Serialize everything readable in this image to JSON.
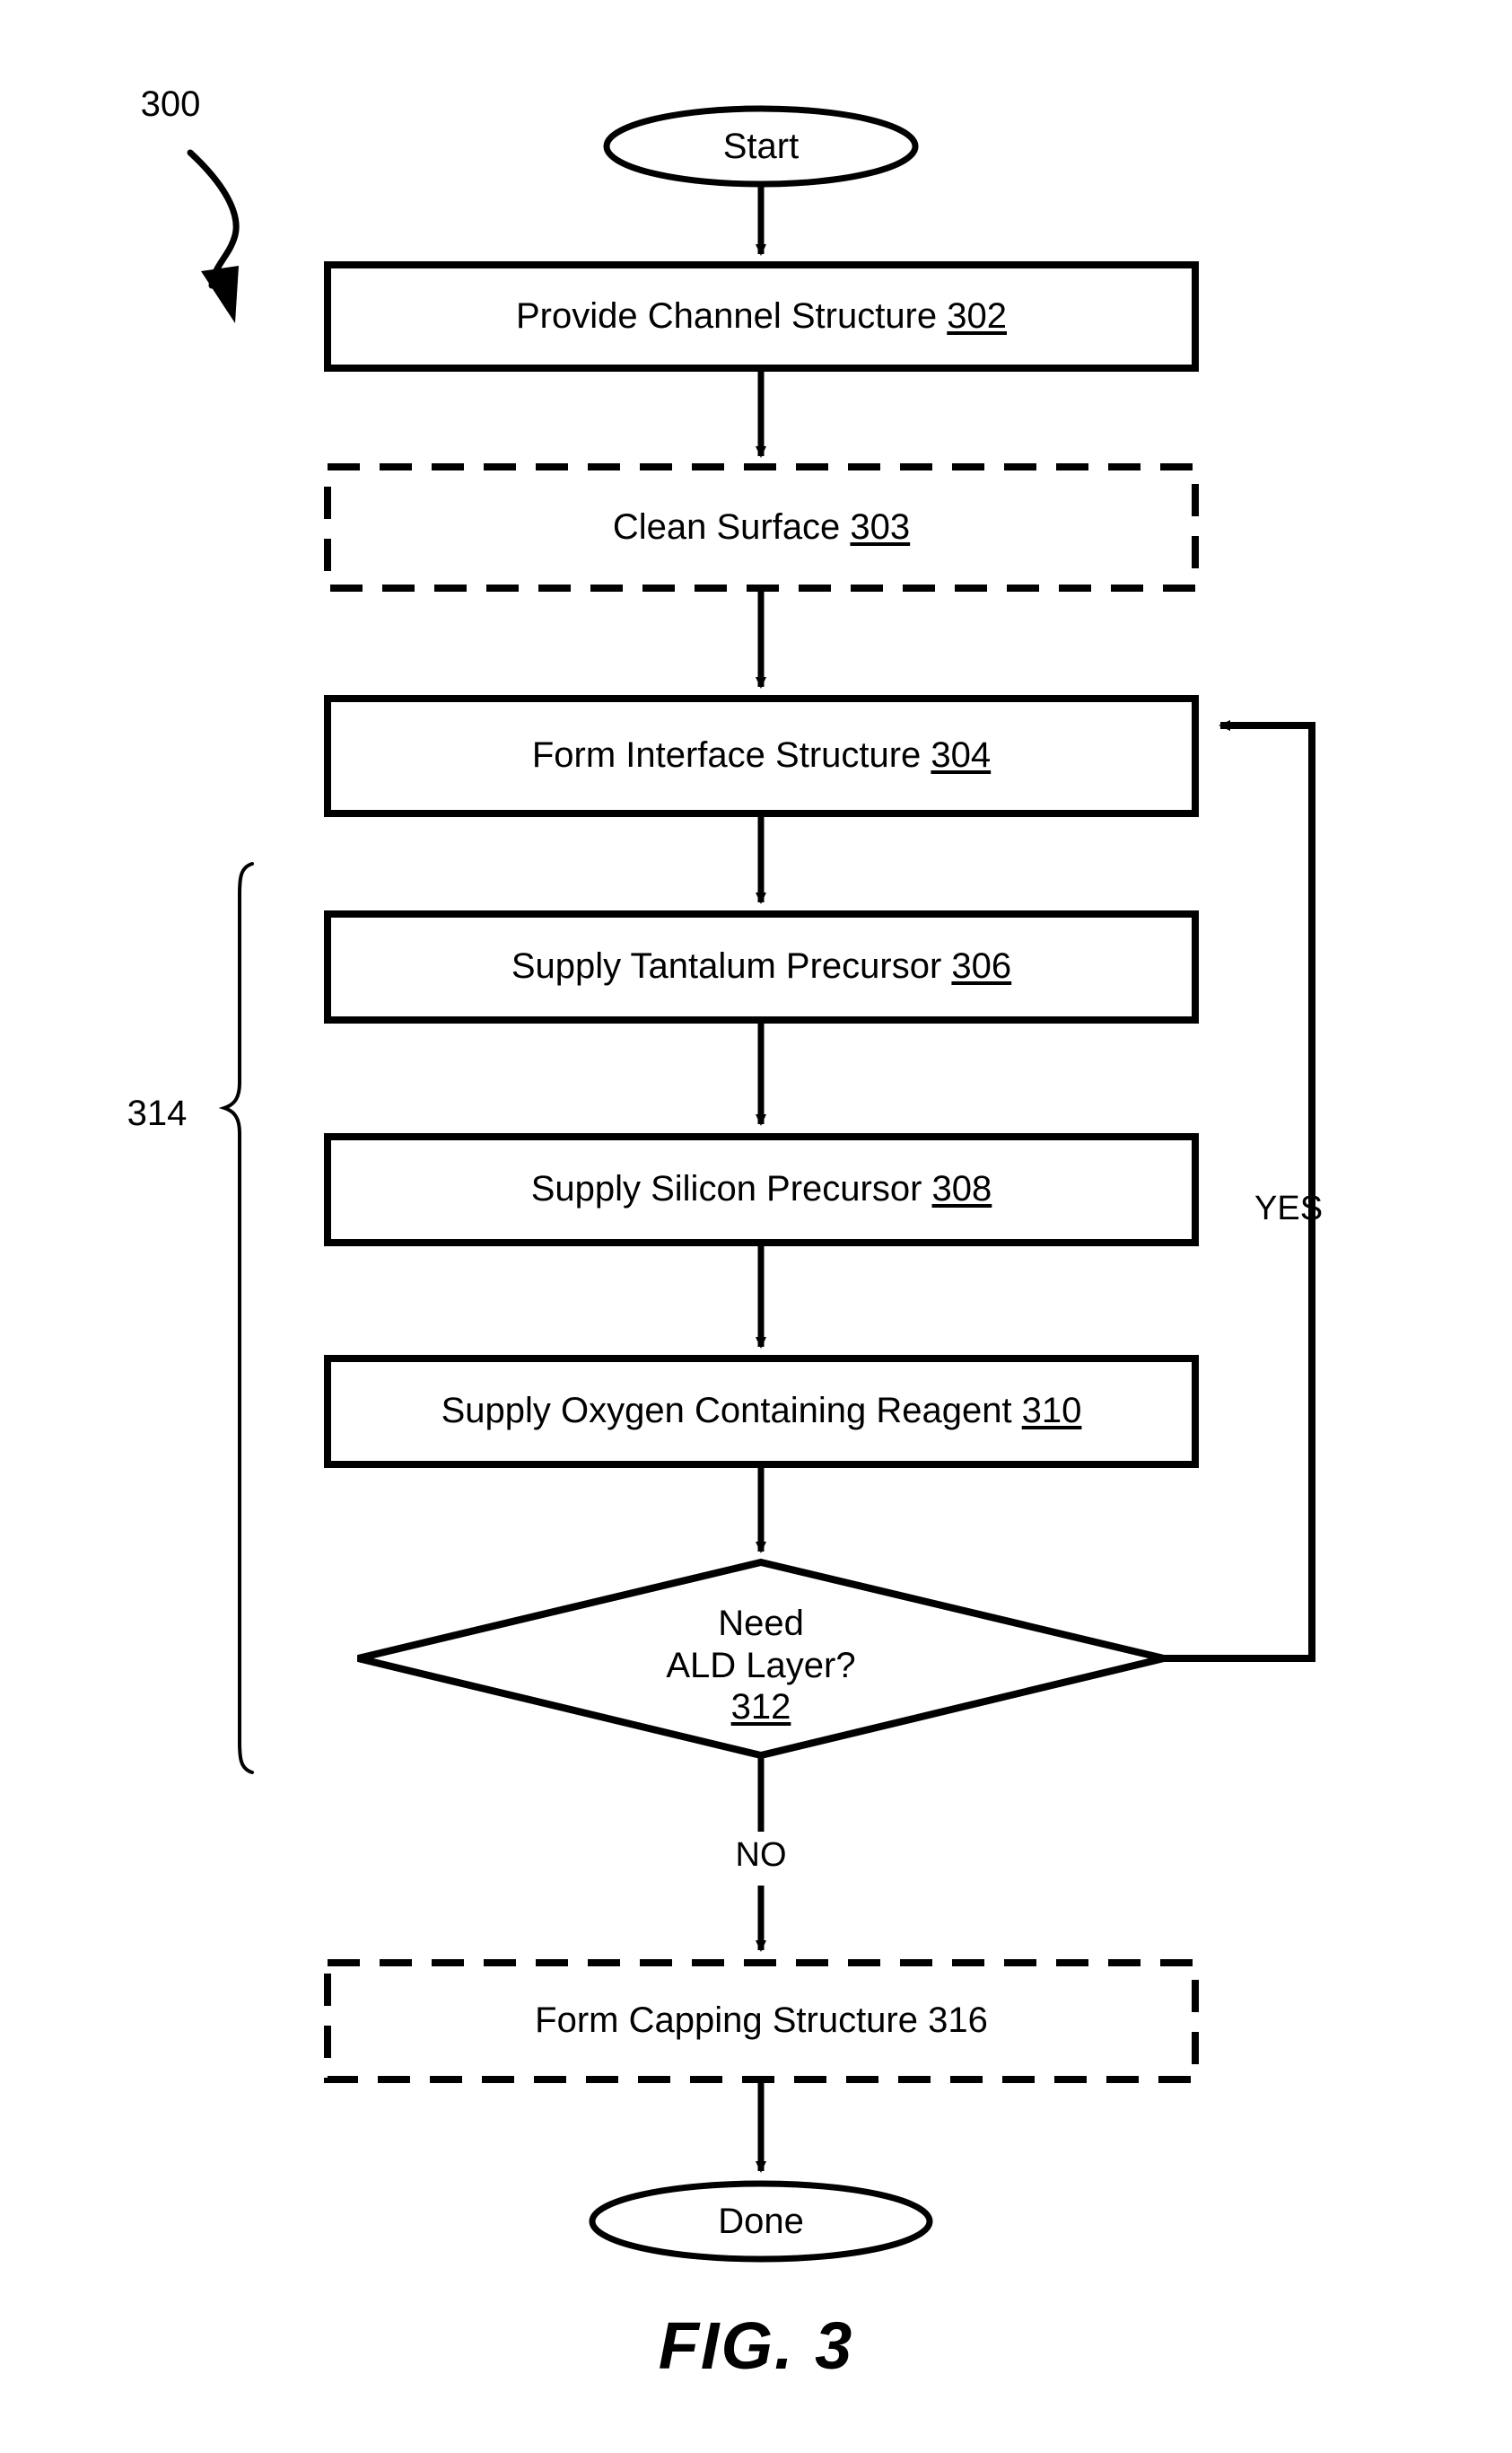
{
  "figure": {
    "caption": "FIG. 3",
    "reference_numeral": "300",
    "group_bracket_label": "314"
  },
  "chart_data": {
    "type": "diagram",
    "diagram_kind": "flowchart",
    "title": "FIG. 3",
    "nodes": [
      {
        "id": "start",
        "shape": "terminator",
        "text": "Start",
        "ref": ""
      },
      {
        "id": "n302",
        "shape": "process",
        "text": "Provide Channel Structure",
        "ref": "302",
        "ref_underlined": true,
        "border": "solid"
      },
      {
        "id": "n303",
        "shape": "process",
        "text": "Clean Surface",
        "ref": "303",
        "ref_underlined": true,
        "border": "dashed"
      },
      {
        "id": "n304",
        "shape": "process",
        "text": "Form Interface Structure",
        "ref": "304",
        "ref_underlined": true,
        "border": "solid"
      },
      {
        "id": "n306",
        "shape": "process",
        "text": "Supply Tantalum Precursor",
        "ref": "306",
        "ref_underlined": true,
        "border": "solid"
      },
      {
        "id": "n308",
        "shape": "process",
        "text": "Supply Silicon Precursor",
        "ref": "308",
        "ref_underlined": true,
        "border": "solid"
      },
      {
        "id": "n310",
        "shape": "process",
        "text": "Supply Oxygen Containing Reagent",
        "ref": "310",
        "ref_underlined": true,
        "border": "solid"
      },
      {
        "id": "n312",
        "shape": "decision",
        "text": "Need\nALD Layer?",
        "ref": "312",
        "ref_underlined": true,
        "border": "solid"
      },
      {
        "id": "n316",
        "shape": "process",
        "text": "Form Capping Structure 316",
        "ref": "",
        "ref_underlined": false,
        "border": "dashed"
      },
      {
        "id": "done",
        "shape": "terminator",
        "text": "Done",
        "ref": ""
      }
    ],
    "edges": [
      {
        "from": "start",
        "to": "n302",
        "label": ""
      },
      {
        "from": "n302",
        "to": "n303",
        "label": ""
      },
      {
        "from": "n303",
        "to": "n304",
        "label": ""
      },
      {
        "from": "n304",
        "to": "n306",
        "label": ""
      },
      {
        "from": "n306",
        "to": "n308",
        "label": ""
      },
      {
        "from": "n308",
        "to": "n310",
        "label": ""
      },
      {
        "from": "n310",
        "to": "n312",
        "label": ""
      },
      {
        "from": "n312",
        "to": "n304",
        "label": "YES"
      },
      {
        "from": "n312",
        "to": "n316",
        "label": "NO"
      },
      {
        "from": "n316",
        "to": "done",
        "label": ""
      }
    ],
    "annotations": [
      {
        "id": "fig-ref",
        "text": "300",
        "note": "curved lead arrow pointing to flowchart"
      },
      {
        "id": "bracket",
        "text": "314",
        "note": "curly brace grouping steps 306-312"
      }
    ]
  },
  "nodes": {
    "start": {
      "label": "Start"
    },
    "n302": {
      "label": "Provide Channel Structure ",
      "ref": "302"
    },
    "n303": {
      "label": "Clean Surface ",
      "ref": "303"
    },
    "n304": {
      "label": "Form Interface Structure ",
      "ref": "304"
    },
    "n306": {
      "label": "Supply Tantalum Precursor ",
      "ref": "306"
    },
    "n308": {
      "label": "Supply Silicon Precursor ",
      "ref": "308"
    },
    "n310": {
      "label": "Supply Oxygen Containing Reagent ",
      "ref": "310"
    },
    "n312": {
      "line1": "Need",
      "line2": "ALD Layer?",
      "ref": "312"
    },
    "n316": {
      "label": "Form Capping Structure 316"
    },
    "done": {
      "label": "Done"
    }
  },
  "edge_labels": {
    "yes": "YES",
    "no": "NO"
  },
  "colors": {
    "ink": "#000000",
    "paper": "#ffffff"
  }
}
